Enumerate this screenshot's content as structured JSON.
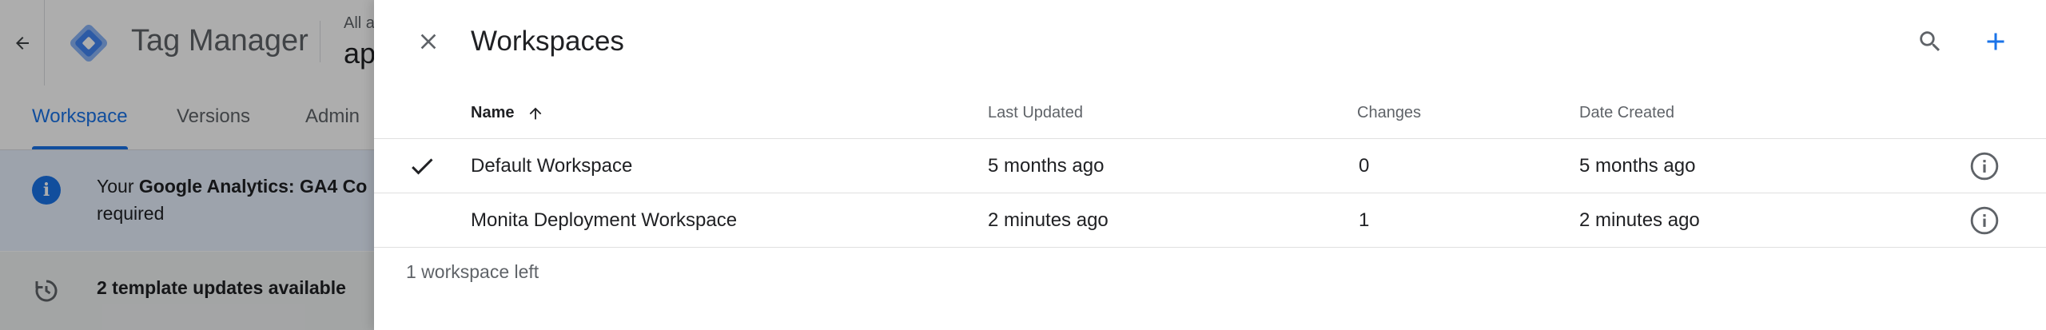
{
  "background": {
    "header": {
      "product_name": "Tag Manager",
      "account_label": "All a",
      "container_name": "ap"
    },
    "tabs": [
      {
        "label": "Workspace",
        "active": true
      },
      {
        "label": "Versions",
        "active": false
      },
      {
        "label": "Admin",
        "active": false
      }
    ],
    "notice": {
      "prefix": "Your ",
      "bold": "Google Analytics: GA4 Co",
      "line2": "required"
    },
    "updates_text": "2 template updates available"
  },
  "panel": {
    "title": "Workspaces",
    "columns": {
      "name": "Name",
      "last_updated": "Last Updated",
      "changes": "Changes",
      "date_created": "Date Created"
    },
    "rows": [
      {
        "name": "Default Workspace",
        "last_updated": "5 months ago",
        "changes": "0",
        "date_created": "5 months ago",
        "selected": true
      },
      {
        "name": "Monita Deployment Workspace",
        "last_updated": "2 minutes ago",
        "changes": "1",
        "date_created": "2 minutes ago",
        "selected": false
      }
    ],
    "footer": "1 workspace left"
  },
  "colors": {
    "accent": "#1a73e8",
    "text_primary": "#202124",
    "text_secondary": "#5f6368",
    "divider": "#e0e0e0"
  },
  "icons": {
    "back": "arrow-back-icon",
    "logo": "gtm-logo-icon",
    "info": "info-icon",
    "update": "refresh-icon",
    "close": "close-icon",
    "search": "search-icon",
    "add": "add-icon",
    "sort": "arrow-up-icon",
    "check": "check-icon",
    "row_info": "info-outline-icon"
  }
}
